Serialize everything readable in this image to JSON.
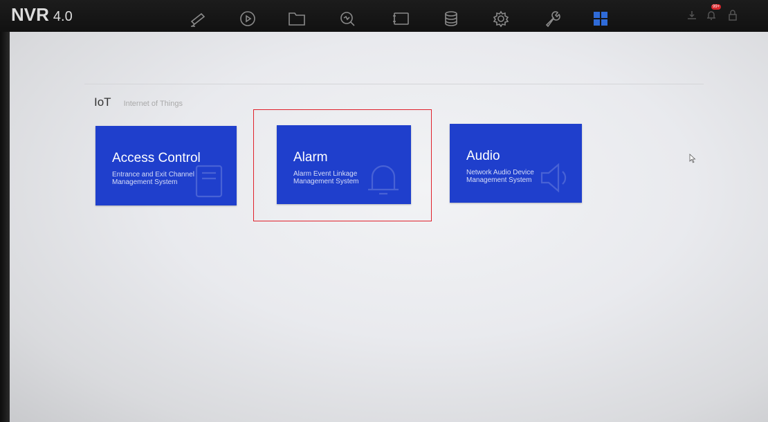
{
  "app": {
    "brand_name": "NVR",
    "brand_version": "4.0"
  },
  "nav": {
    "icons": [
      "camera-icon",
      "playback-icon",
      "folder-icon",
      "search-analysis-icon",
      "channel-icon",
      "storage-icon",
      "settings-icon",
      "maintenance-icon",
      "apps-grid-icon"
    ],
    "active": "apps-grid-icon",
    "active_color": "#2f6bd8"
  },
  "header_right": {
    "icons": [
      "download-icon",
      "notification-icon",
      "lock-icon"
    ],
    "badge": "99+",
    "badge_color": "#d8262b"
  },
  "iot": {
    "abbr": "IoT",
    "subtitle": "Internet of Things"
  },
  "tiles": [
    {
      "title": "Access Control",
      "description": "Entrance and Exit Channel\nManagement System",
      "icon": "access-card-icon"
    },
    {
      "title": "Alarm",
      "description": "Alarm Event Linkage\nManagement System",
      "icon": "bell-icon"
    },
    {
      "title": "Audio",
      "description": "Network Audio Device\nManagement System",
      "icon": "speaker-icon"
    }
  ],
  "colors": {
    "tile": "#1f3fcc",
    "highlight_box": "#e0202a"
  }
}
